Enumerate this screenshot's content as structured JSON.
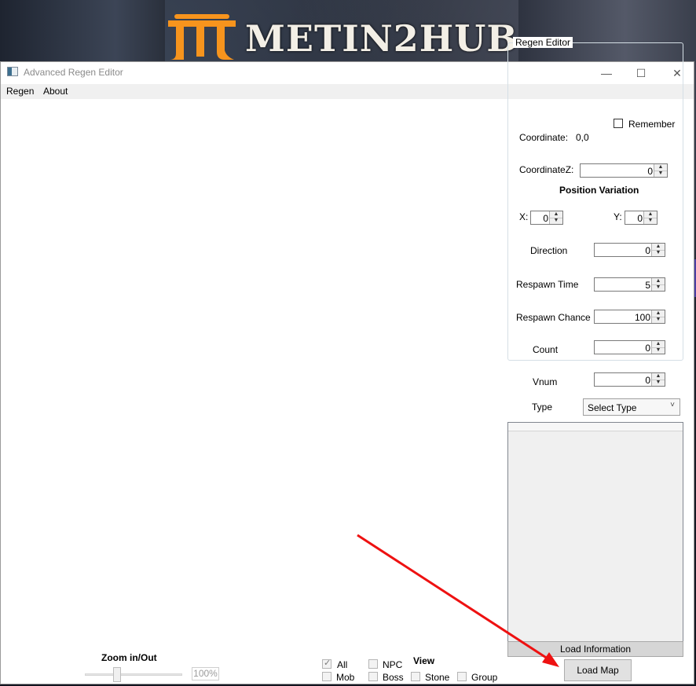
{
  "banner": {
    "logo_text": "METIN2HUB"
  },
  "window": {
    "title": "Advanced Regen Editor",
    "controls": {
      "minimize": "—",
      "maximize": "☐",
      "close": "✕"
    }
  },
  "menu": {
    "items": [
      "Regen",
      "About"
    ]
  },
  "regen_editor": {
    "legend": "Regen Editor",
    "remember_label": "Remember",
    "remember_checked": false,
    "coordinate_label": "Coordinate:",
    "coordinate_value": "0,0",
    "coordinate_z_label": "CoordinateZ:",
    "coordinate_z_value": "0",
    "position_variation_label": "Position Variation",
    "x_label": "X:",
    "x_value": "0",
    "y_label": "Y:",
    "y_value": "0",
    "direction_label": "Direction",
    "direction_value": "0",
    "respawn_time_label": "Respawn Time",
    "respawn_time_value": "5",
    "respawn_chance_label": "Respawn Chance",
    "respawn_chance_value": "100",
    "count_label": "Count",
    "count_value": "0",
    "vnum_label": "Vnum",
    "vnum_value": "0",
    "type_label": "Type",
    "type_selected": "Select Type"
  },
  "load_information_label": "Load Information",
  "load_map_label": "Load Map",
  "zoom": {
    "label": "Zoom in/Out",
    "percent": "100%"
  },
  "view": {
    "label": "View",
    "filters": [
      {
        "label": "All",
        "checked": true
      },
      {
        "label": "NPC",
        "checked": false
      },
      {
        "label": "Mob",
        "checked": false
      },
      {
        "label": "Boss",
        "checked": false
      },
      {
        "label": "Stone",
        "checked": false
      },
      {
        "label": "Group",
        "checked": false
      }
    ]
  },
  "colors": {
    "annotation_arrow": "#ee1111",
    "logo_accent": "#f7941d"
  }
}
